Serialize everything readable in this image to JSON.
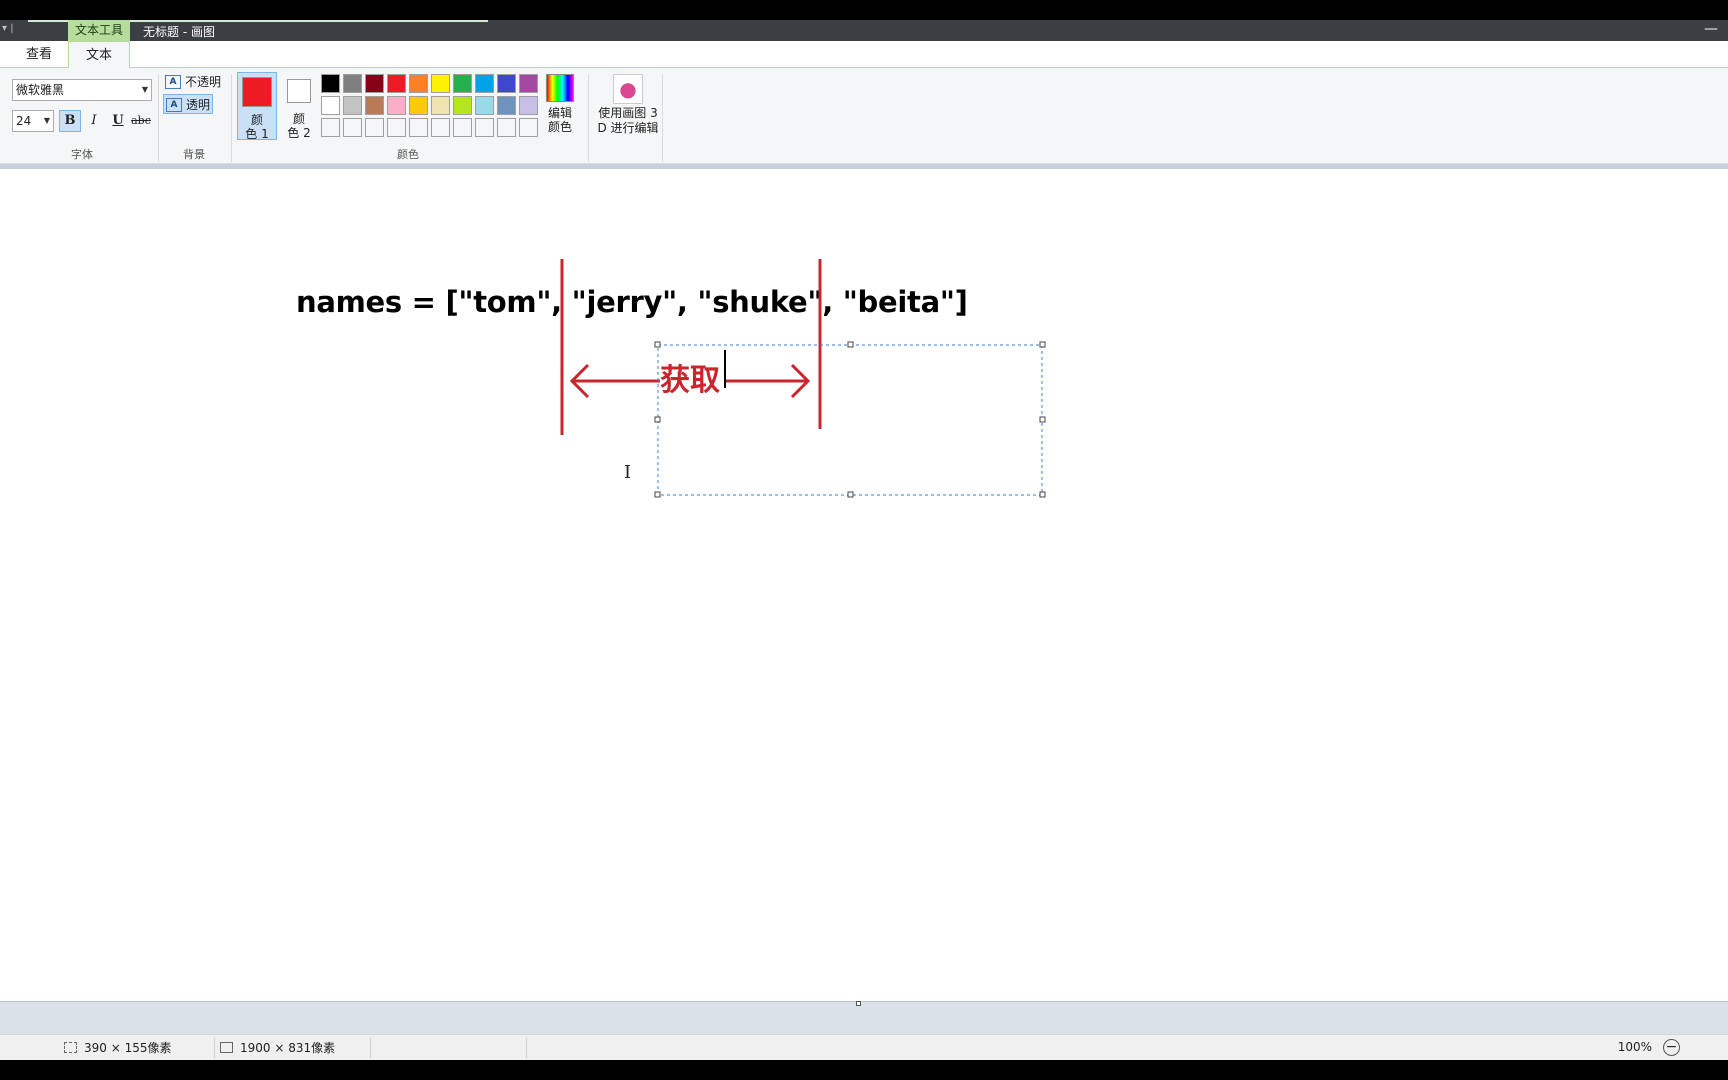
{
  "titlebar": {
    "context_tab": "文本工具",
    "window_title": "无标题 - 画图",
    "minimize": "—"
  },
  "tabs": {
    "view": "查看",
    "text": "文本"
  },
  "font_group": {
    "font_name": "微软雅黑",
    "font_size": "24",
    "bold": "B",
    "italic": "I",
    "underline": "U",
    "strikethrough": "abc",
    "label": "字体"
  },
  "background_group": {
    "opaque": "不透明",
    "transparent": "透明",
    "icon_glyph": "A",
    "label": "背景"
  },
  "colors_group": {
    "color1_label_a": "颜",
    "color1_label_b": "色 1",
    "color2_label_a": "颜",
    "color2_label_b": "色 2",
    "color1_value": "#ed1c24",
    "color2_value": "#ffffff",
    "edit_colors_a": "编辑",
    "edit_colors_b": "颜色",
    "label": "颜色",
    "palette_row1": [
      "#000000",
      "#7f7f7f",
      "#880015",
      "#ed1c24",
      "#ff7f27",
      "#fff200",
      "#22b14c",
      "#00a2e8",
      "#3f48cc",
      "#a349a4"
    ],
    "palette_row2": [
      "#ffffff",
      "#c3c3c3",
      "#b97a57",
      "#ffaec9",
      "#ffc90e",
      "#efe4b0",
      "#b5e61d",
      "#99d9ea",
      "#7092be",
      "#c8bfe7"
    ],
    "palette_row3": [
      "#f5f6f7",
      "#f5f6f7",
      "#f5f6f7",
      "#f5f6f7",
      "#f5f6f7",
      "#f5f6f7",
      "#f5f6f7",
      "#f5f6f7",
      "#f5f6f7",
      "#f5f6f7"
    ]
  },
  "paint3d": {
    "line1": "使用画图 3",
    "line2": "D 进行编辑",
    "icon": "paint-3d-icon"
  },
  "canvas": {
    "code_line": "names = [\"tom\", \"jerry\", \"shuke\", \"beita\"]",
    "annotation": "获取",
    "annotation_color": "#c8262d"
  },
  "statusbar": {
    "selection_size": "390 × 155像素",
    "canvas_size": "1900 × 831像素",
    "zoom": "100%",
    "zoom_out": "−"
  }
}
